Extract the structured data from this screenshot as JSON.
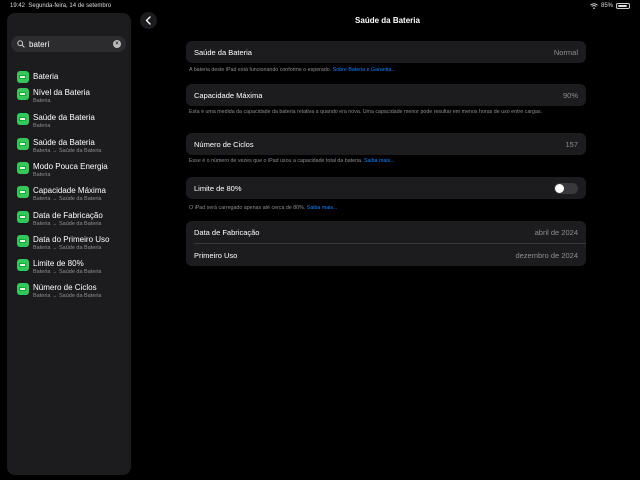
{
  "status_bar": {
    "time": "19:42",
    "date": "Segunda-feira, 14 de setembro",
    "battery_percent": "85%"
  },
  "search": {
    "value": "baterí",
    "placeholder": "Pesquisar"
  },
  "results": [
    {
      "title": "Bateria",
      "subtitle": ""
    },
    {
      "title": "Nível da Bateria",
      "subtitle": "Bateria"
    },
    {
      "title": "Saúde da Bateria",
      "subtitle": "Bateria"
    },
    {
      "title": "Saúde da Bateria",
      "subtitle": "Bateria → Saúde da Bateria"
    },
    {
      "title": "Modo Pouca Energia",
      "subtitle": "Bateria"
    },
    {
      "title": "Capacidade Máxima",
      "subtitle": "Bateria → Saúde da Bateria"
    },
    {
      "title": "Data de Fabricação",
      "subtitle": "Bateria → Saúde da Bateria"
    },
    {
      "title": "Data do Primeiro Uso",
      "subtitle": "Bateria → Saúde da Bateria"
    },
    {
      "title": "Limite de 80%",
      "subtitle": "Bateria → Saúde da Bateria"
    },
    {
      "title": "Número de Ciclos",
      "subtitle": "Bateria → Saúde da Bateria"
    }
  ],
  "page": {
    "title": "Saúde da Bateria"
  },
  "health": {
    "label": "Saúde da Bateria",
    "value": "Normal",
    "note": "A bateria deste iPad está funcionando conforme o esperado.",
    "link": "Sobre Bateria e Garantia..."
  },
  "capacity": {
    "label": "Capacidade Máxima",
    "value": "90%",
    "note": "Esta é uma medida da capacidade da bateria relativa a quando era nova. Uma capacidade menor pode resultar em menos horas de uso entre cargas."
  },
  "cycles": {
    "label": "Número de Ciclos",
    "value": "157",
    "note": "Esse é o número de vezes que o iPad usou a capacidade total da bateria.",
    "link": "Saiba mais..."
  },
  "limit": {
    "label": "Limite de 80%",
    "enabled": false,
    "note": "O iPad será carregado apenas até cerca de 80%.",
    "link": "Saiba mais..."
  },
  "dates": {
    "manufacture_label": "Data de Fabricação",
    "manufacture_value": "abril de 2024",
    "first_use_label": "Primeiro Uso",
    "first_use_value": "dezembro de 2024"
  }
}
